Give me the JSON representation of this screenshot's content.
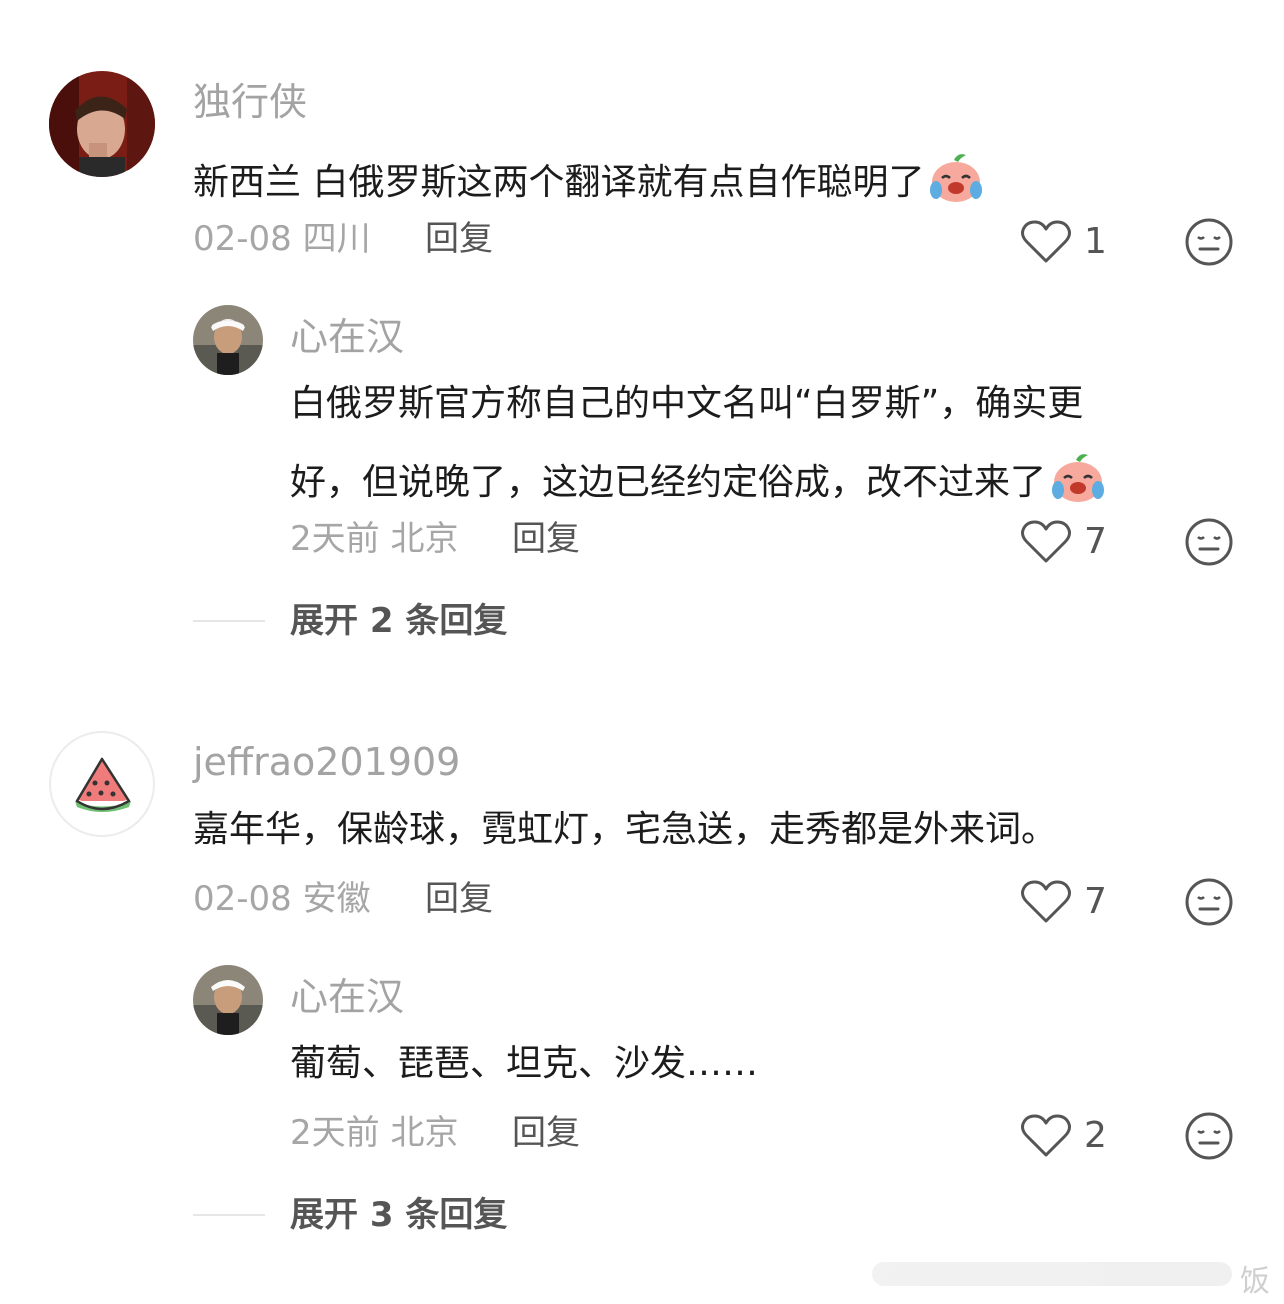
{
  "colors": {
    "meta_gray": "#a6a6a6",
    "body": "#1c1c1c",
    "icon_gray": "#555555"
  },
  "comments": [
    {
      "author": "独行侠",
      "text": "新西兰 白俄罗斯这两个翻译就有点自作聪明了",
      "emoji": "crying-laughing-peach-emoji",
      "date_location": "02-08 四川",
      "reply_label": "回复",
      "likes": "1",
      "reply": {
        "author": "心在汉",
        "text_line1": "白俄罗斯官方称自己的中文名叫“白罗斯”，确实更",
        "text_line2": "好，但说晚了，这边已经约定俗成，改不过来了",
        "emoji": "crying-laughing-peach-emoji",
        "date_location": "2天前 北京",
        "reply_label": "回复",
        "likes": "7"
      },
      "expand_label": "展开 2 条回复"
    },
    {
      "author": "jeffrao201909",
      "text": "嘉年华，保龄球，霓虹灯，宅急送，走秀都是外来词。",
      "date_location": "02-08 安徽",
      "reply_label": "回复",
      "likes": "7",
      "reply": {
        "author": "心在汉",
        "text_line1": "葡萄、琵琶、坦克、沙发……",
        "date_location": "2天前 北京",
        "reply_label": "回复",
        "likes": "2"
      },
      "expand_label": "展开 3 条回复"
    }
  ],
  "watermark_text": "饭"
}
